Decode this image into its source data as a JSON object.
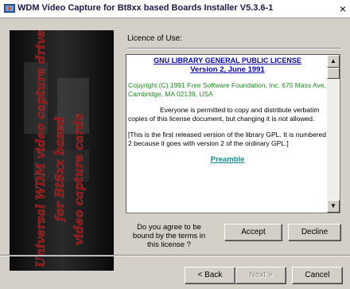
{
  "window": {
    "title": "WDM Video Capture for Bt8xx based Boards Installer V5.3.6-1",
    "close_glyph": "×"
  },
  "banner": {
    "lines": [
      "Universal WDM video capture driver",
      "for Bt8xx based",
      "video capture cards"
    ]
  },
  "license": {
    "label": "Licence of Use:",
    "title": "GNU LIBRARY GENERAL PUBLIC LICENSE",
    "version": "Version 2, June 1991",
    "copyright": "Copyright (C) 1991 Free Software Foundation, Inc. 675 Mass Ave, Cambridge, MA 02139, USA",
    "para1": "Everyone is permitted to copy and distribute verbatim copies of this license document, but changing it is not allowed.",
    "para2": "[This is the first released version of the library GPL.  It is numbered 2 because it goes with version 2 of the ordinary GPL.]",
    "preamble": "Preamble",
    "scroll_up": "▲",
    "scroll_down": "▼"
  },
  "agreement": {
    "question": "Do you agree to be bound by the terms in this license ?",
    "accept_label": "Accept",
    "decline_label": "Decline"
  },
  "nav": {
    "back_label": "< Back",
    "next_label": "Next >",
    "cancel_label": "Cancel"
  },
  "colors": {
    "title_blue": "#0a0ab0",
    "copyright_green": "#1a8a1a",
    "preamble_teal": "#1a8a8a",
    "banner_text": "#8a1010"
  }
}
